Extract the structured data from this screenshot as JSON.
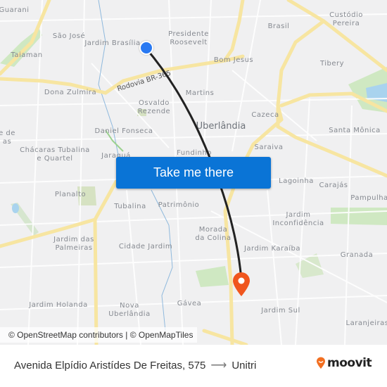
{
  "map": {
    "labels": [
      {
        "text": "Guarani",
        "kind": "area"
      },
      {
        "text": "São José",
        "kind": "area"
      },
      {
        "text": "Jardim Brasília",
        "kind": "area"
      },
      {
        "text": "Presidente\nRoosevelt",
        "kind": "area"
      },
      {
        "text": "Brasil",
        "kind": "area"
      },
      {
        "text": "Custódio\nPereira",
        "kind": "area"
      },
      {
        "text": "Taiaman",
        "kind": "area"
      },
      {
        "text": "Bom Jesus",
        "kind": "area"
      },
      {
        "text": "Tibery",
        "kind": "area"
      },
      {
        "text": "Rodovia BR-365",
        "kind": "road"
      },
      {
        "text": "Dona Zulmira",
        "kind": "area"
      },
      {
        "text": "Martins",
        "kind": "area"
      },
      {
        "text": "Osvaldo\nRezende",
        "kind": "area"
      },
      {
        "text": "Cazeca",
        "kind": "area"
      },
      {
        "text": "Uberlândia",
        "kind": "city"
      },
      {
        "text": "Daniel Fonseca",
        "kind": "area"
      },
      {
        "text": "Santa Mônica",
        "kind": "area"
      },
      {
        "text": "e de\nas",
        "kind": "area"
      },
      {
        "text": "Chácaras Tubalina\ne Quartel",
        "kind": "area"
      },
      {
        "text": "Jaraguá",
        "kind": "area"
      },
      {
        "text": "Fundinho",
        "kind": "area"
      },
      {
        "text": "Saraiva",
        "kind": "area"
      },
      {
        "text": "Lagoinha",
        "kind": "area"
      },
      {
        "text": "Carajás",
        "kind": "area"
      },
      {
        "text": "Planalto",
        "kind": "area"
      },
      {
        "text": "Pampulha",
        "kind": "area"
      },
      {
        "text": "Tubalina",
        "kind": "area"
      },
      {
        "text": "Patrimônio",
        "kind": "area"
      },
      {
        "text": "Jardim\nInconfidência",
        "kind": "area"
      },
      {
        "text": "Morada\nda Colina",
        "kind": "area"
      },
      {
        "text": "Jardim das\nPalmeiras",
        "kind": "area"
      },
      {
        "text": "Cidade Jardim",
        "kind": "area"
      },
      {
        "text": "Jardim Karaíba",
        "kind": "area"
      },
      {
        "text": "Granada",
        "kind": "area"
      },
      {
        "text": "Jardim Holanda",
        "kind": "area"
      },
      {
        "text": "Nova\nUberlândia",
        "kind": "area"
      },
      {
        "text": "Gávea",
        "kind": "area"
      },
      {
        "text": "Jardim Sul",
        "kind": "area"
      },
      {
        "text": "Laranjeiras",
        "kind": "area"
      }
    ],
    "origin_marker": "origin-dot",
    "destination_marker": "destination-pin",
    "route_color": "#222222",
    "attribution": "© OpenStreetMap contributors | © OpenMapTiles"
  },
  "cta": {
    "label": "Take me there",
    "color": "#0a74d6"
  },
  "footer": {
    "origin": "Avenida Elpídio Aristídes De Freitas, 575",
    "arrow": "⟶",
    "destination": "Unitri",
    "brand": "moovit",
    "brand_color": "#f26f21"
  }
}
